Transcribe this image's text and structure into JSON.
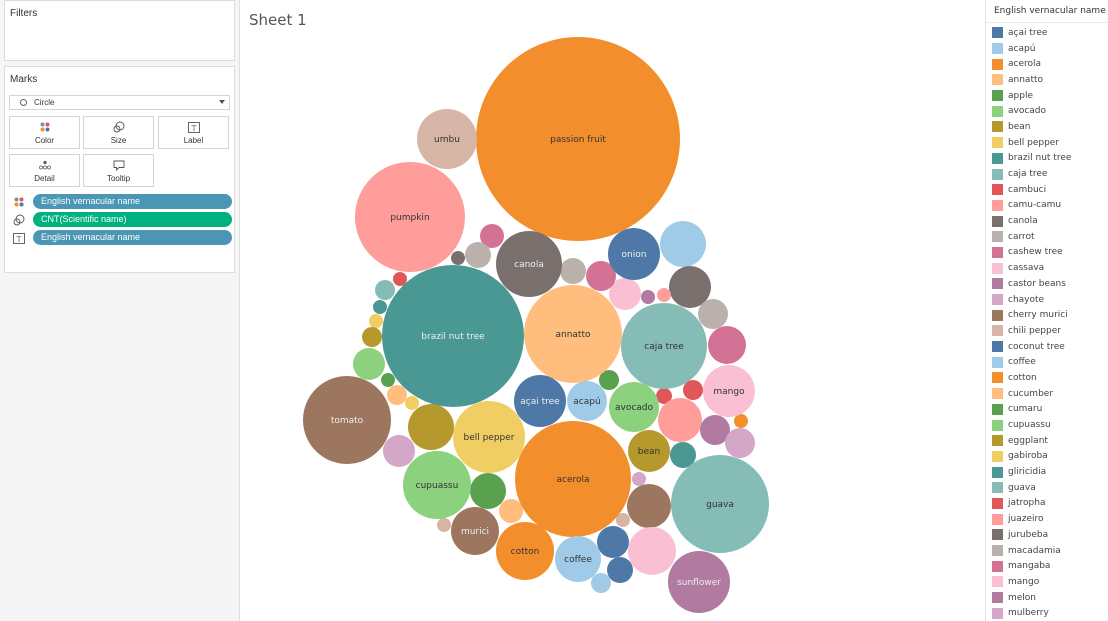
{
  "left_panel": {
    "filters": {
      "title": "Filters"
    },
    "marks": {
      "title": "Marks",
      "mark_type": "Circle",
      "buttons": {
        "color": "Color",
        "size": "Size",
        "label": "Label",
        "detail": "Detail",
        "tooltip": "Tooltip"
      },
      "pills": [
        {
          "icon": "color-icon",
          "label": "English vernacular name",
          "color": "#4a96b4"
        },
        {
          "icon": "size-icon",
          "label": "CNT(Scientific name)",
          "color": "#00b180"
        },
        {
          "icon": "label-icon",
          "label": "English vernacular name",
          "color": "#4a96b4"
        }
      ]
    }
  },
  "sheet": {
    "title": "Sheet 1"
  },
  "legend": {
    "title": "English vernacular name",
    "items": [
      {
        "label": "açai tree",
        "color": "#4e79a7"
      },
      {
        "label": "acapú",
        "color": "#a0cbe8"
      },
      {
        "label": "acerola",
        "color": "#f28e2b"
      },
      {
        "label": "annatto",
        "color": "#ffbe7d"
      },
      {
        "label": "apple",
        "color": "#59a14f"
      },
      {
        "label": "avocado",
        "color": "#8cd17d"
      },
      {
        "label": "bean",
        "color": "#b6992d"
      },
      {
        "label": "bell pepper",
        "color": "#f1ce63"
      },
      {
        "label": "brazil nut tree",
        "color": "#499894"
      },
      {
        "label": "caja tree",
        "color": "#86bcb6"
      },
      {
        "label": "cambuci",
        "color": "#e15759"
      },
      {
        "label": "camu-camu",
        "color": "#ff9d9a"
      },
      {
        "label": "canola",
        "color": "#79706e"
      },
      {
        "label": "carrot",
        "color": "#bab0ac"
      },
      {
        "label": "cashew tree",
        "color": "#d37295"
      },
      {
        "label": "cassava",
        "color": "#fabfd2"
      },
      {
        "label": "castor beans",
        "color": "#b07aa1"
      },
      {
        "label": "chayote",
        "color": "#d4a6c8"
      },
      {
        "label": "cherry murici",
        "color": "#9d7660"
      },
      {
        "label": "chili pepper",
        "color": "#d7b5a6"
      },
      {
        "label": "coconut tree",
        "color": "#4e79a7"
      },
      {
        "label": "coffee",
        "color": "#a0cbe8"
      },
      {
        "label": "cotton",
        "color": "#f28e2b"
      },
      {
        "label": "cucumber",
        "color": "#ffbe7d"
      },
      {
        "label": "cumaru",
        "color": "#59a14f"
      },
      {
        "label": "cupuassu",
        "color": "#8cd17d"
      },
      {
        "label": "eggplant",
        "color": "#b6992d"
      },
      {
        "label": "gabiroba",
        "color": "#f1ce63"
      },
      {
        "label": "gliricidia",
        "color": "#499894"
      },
      {
        "label": "guava",
        "color": "#86bcb6"
      },
      {
        "label": "jatropha",
        "color": "#e15759"
      },
      {
        "label": "juazeiro",
        "color": "#ff9d9a"
      },
      {
        "label": "jurubeba",
        "color": "#79706e"
      },
      {
        "label": "macadamia",
        "color": "#bab0ac"
      },
      {
        "label": "mangaba",
        "color": "#d37295"
      },
      {
        "label": "mango",
        "color": "#fabfd2"
      },
      {
        "label": "melon",
        "color": "#b07aa1"
      },
      {
        "label": "mulberry",
        "color": "#d4a6c8"
      }
    ]
  },
  "chart_data": {
    "type": "bubble",
    "title": "Sheet 1",
    "size_measure": "CNT(Scientific name)",
    "color_dimension": "English vernacular name",
    "label_dimension": "English vernacular name",
    "bubbles": [
      {
        "label": "passion fruit",
        "color": "#f28e2b",
        "value": 100,
        "show_label": true,
        "text_color": "#333"
      },
      {
        "label": "brazil nut tree",
        "color": "#499894",
        "value": 56,
        "show_label": true,
        "text_color": "#eee"
      },
      {
        "label": "pumpkin",
        "color": "#ff9d9a",
        "value": 34,
        "show_label": true,
        "text_color": "#333"
      },
      {
        "label": "acerola",
        "color": "#f28e2b",
        "value": 37,
        "show_label": true,
        "text_color": "#333"
      },
      {
        "label": "guava",
        "color": "#86bcb6",
        "value": 27,
        "show_label": true,
        "text_color": "#333"
      },
      {
        "label": "annatto",
        "color": "#ffbe7d",
        "value": 26,
        "show_label": true,
        "text_color": "#333"
      },
      {
        "label": "tomato",
        "color": "#9d7660",
        "value": 21,
        "show_label": true,
        "text_color": "#eee"
      },
      {
        "label": "caja tree",
        "color": "#86bcb6",
        "value": 20,
        "show_label": true,
        "text_color": "#333"
      },
      {
        "label": "bell pepper",
        "color": "#f1ce63",
        "value": 14,
        "show_label": true,
        "text_color": "#333"
      },
      {
        "label": "cupuassu",
        "color": "#8cd17d",
        "value": 12,
        "show_label": true,
        "text_color": "#333"
      },
      {
        "label": "sunflower",
        "color": "#b07aa1",
        "value": 11,
        "show_label": true,
        "text_color": "#eee"
      },
      {
        "label": "canola",
        "color": "#79706e",
        "value": 12,
        "show_label": true,
        "text_color": "#eee"
      },
      {
        "label": "umbu",
        "color": "#d7b5a6",
        "value": 10,
        "show_label": true,
        "text_color": "#333"
      },
      {
        "label": "cotton",
        "color": "#f28e2b",
        "value": 9,
        "show_label": true,
        "text_color": "#333"
      },
      {
        "label": "onion",
        "color": "#4e79a7",
        "value": 7,
        "show_label": true,
        "text_color": "#eee"
      },
      {
        "label": "mango",
        "color": "#fabfd2",
        "value": 7,
        "show_label": true,
        "text_color": "#333"
      },
      {
        "label": "avocado",
        "color": "#8cd17d",
        "value": 7,
        "show_label": true,
        "text_color": "#333"
      },
      {
        "label": "açai tree",
        "color": "#4e79a7",
        "value": 7,
        "show_label": true,
        "text_color": "#eee"
      },
      {
        "label": "coffee",
        "color": "#a0cbe8",
        "value": 6,
        "show_label": true,
        "text_color": "#333"
      },
      {
        "label": "acapú",
        "color": "#a0cbe8",
        "value": 5,
        "show_label": true,
        "text_color": "#333"
      },
      {
        "label": "murici",
        "color": "#9d7660",
        "value": 6,
        "show_label": true,
        "text_color": "#eee"
      },
      {
        "label": "bean",
        "color": "#b6992d",
        "value": 5,
        "show_label": true,
        "text_color": "#333"
      }
    ]
  }
}
